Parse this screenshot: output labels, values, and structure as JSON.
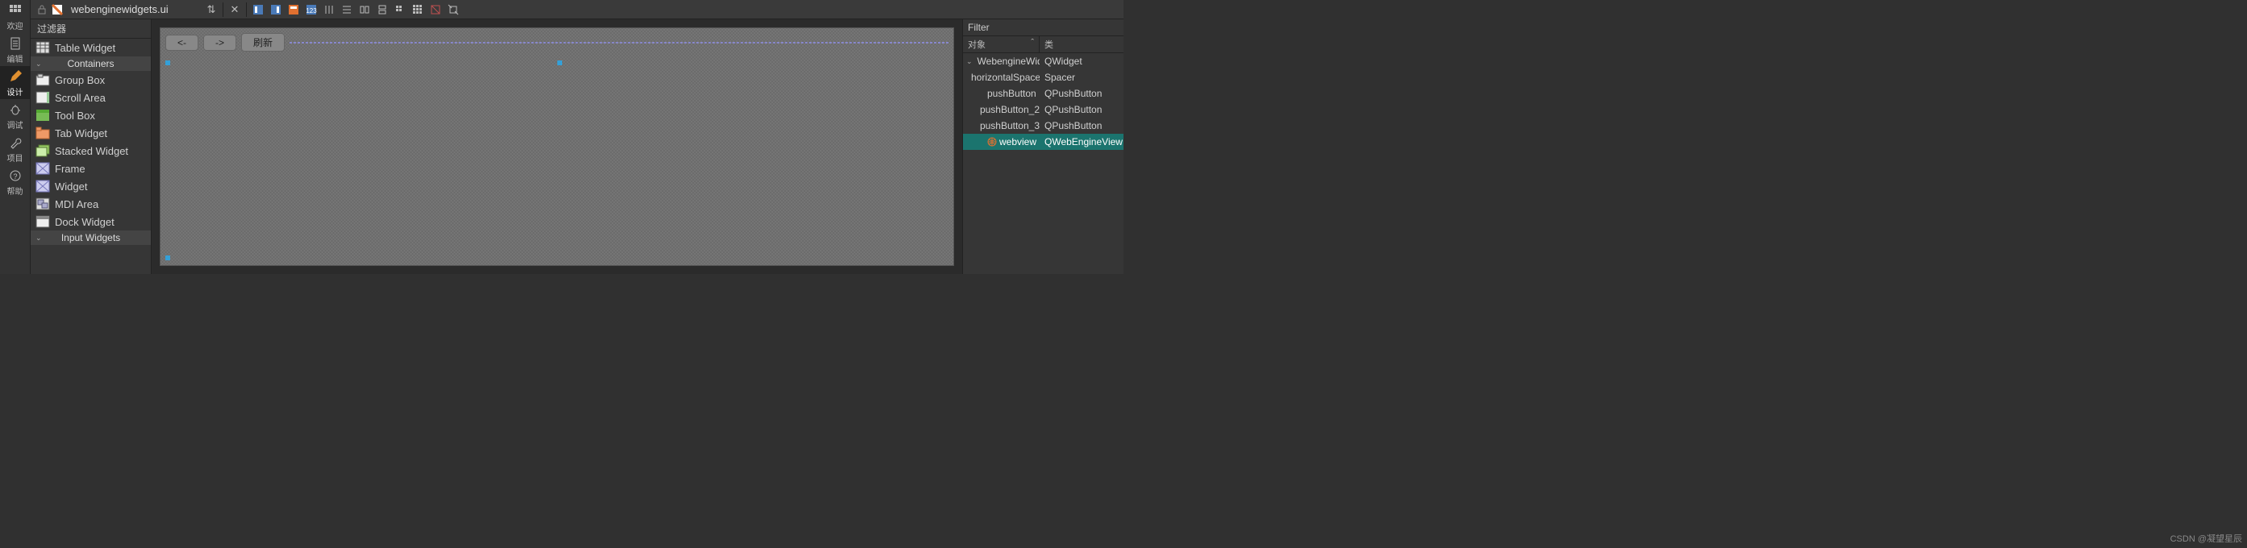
{
  "nav": {
    "items": [
      {
        "id": "welcome",
        "label": "欢迎"
      },
      {
        "id": "edit",
        "label": "编辑"
      },
      {
        "id": "design",
        "label": "设计",
        "active": true
      },
      {
        "id": "debug",
        "label": "调试"
      },
      {
        "id": "project",
        "label": "项目"
      },
      {
        "id": "help",
        "label": "帮助"
      }
    ]
  },
  "topbar": {
    "filename": "webenginewidgets.ui",
    "buttons": [
      "updown",
      "close",
      "layout-h",
      "layout-v",
      "layout-hb",
      "layout-vb",
      "layout-hstrip",
      "layout-lines",
      "split-h",
      "split-v",
      "grid-s",
      "grid-l",
      "break",
      "adjust"
    ]
  },
  "widgetbox": {
    "filter_label": "过滤器",
    "top_item": {
      "label": "Table Widget",
      "icon": "table"
    },
    "groups": [
      {
        "title": "Containers",
        "items": [
          {
            "label": "Group Box",
            "icon": "groupbox"
          },
          {
            "label": "Scroll Area",
            "icon": "scroll"
          },
          {
            "label": "Tool Box",
            "icon": "toolbox"
          },
          {
            "label": "Tab Widget",
            "icon": "tab"
          },
          {
            "label": "Stacked Widget",
            "icon": "stacked"
          },
          {
            "label": "Frame",
            "icon": "frame"
          },
          {
            "label": "Widget",
            "icon": "widget"
          },
          {
            "label": "MDI Area",
            "icon": "mdi"
          },
          {
            "label": "Dock Widget",
            "icon": "dock"
          }
        ]
      },
      {
        "title": "Input Widgets",
        "items": []
      }
    ]
  },
  "form": {
    "buttons": [
      {
        "id": "back",
        "label": "<-"
      },
      {
        "id": "forward",
        "label": "->"
      },
      {
        "id": "refresh",
        "label": "刷新"
      }
    ]
  },
  "inspector": {
    "filter_label": "Filter",
    "columns": {
      "object": "对象",
      "class": "类"
    },
    "tree": [
      {
        "obj": "WebengineWidgets",
        "cls": "QWidget",
        "depth": 0,
        "expandable": true,
        "icon": "form"
      },
      {
        "obj": "horizontalSpacer",
        "cls": "Spacer",
        "depth": 1
      },
      {
        "obj": "pushButton",
        "cls": "QPushButton",
        "depth": 1
      },
      {
        "obj": "pushButton_2",
        "cls": "QPushButton",
        "depth": 1
      },
      {
        "obj": "pushButton_3",
        "cls": "QPushButton",
        "depth": 1
      },
      {
        "obj": "webview",
        "cls": "QWebEngineView",
        "depth": 1,
        "selected": true,
        "icon": "web"
      }
    ]
  },
  "watermark": "CSDN @凝望星辰"
}
